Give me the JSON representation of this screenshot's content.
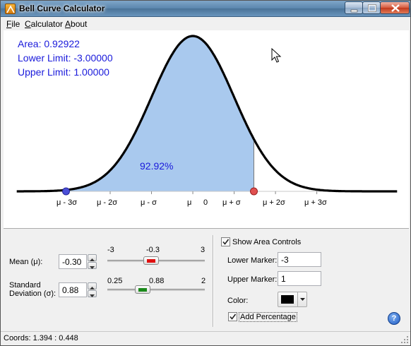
{
  "window": {
    "title": "Bell Curve Calculator"
  },
  "menu": [
    {
      "accel": "F",
      "rest": "ile"
    },
    {
      "accel": "C",
      "rest": "alculator"
    },
    {
      "accel": "A",
      "rest": "bout"
    }
  ],
  "results": {
    "area_line": "Area: 0.92922",
    "lower_line": "Lower Limit: -3.00000",
    "upper_line": "Upper Limit: 1.00000",
    "percentage": "92.92%"
  },
  "axis": {
    "labels": [
      "μ - 3σ",
      "μ - 2σ",
      "μ - σ",
      "μ",
      "0",
      "μ + σ",
      "μ + 2σ",
      "μ + 3σ"
    ]
  },
  "controls": {
    "mean": {
      "label": "Mean (μ):",
      "value": "-0.30",
      "min_label": "-3",
      "current_label": "-0.3",
      "max_label": "3",
      "min": -3,
      "max": 3,
      "current": -0.3,
      "thumb_color": "#e01010"
    },
    "stddev": {
      "label_line1": "Standard",
      "label_line2": "Deviation (σ):",
      "value": "0.88",
      "min_label": "0.25",
      "current_label": "0.88",
      "max_label": "2",
      "min": 0.25,
      "max": 2,
      "current": 0.88,
      "thumb_color": "#1a8a1a"
    },
    "show_area_controls": {
      "label": "Show Area Controls",
      "checked": true
    },
    "lower_marker": {
      "label": "Lower Marker:",
      "value": "-3"
    },
    "upper_marker": {
      "label": "Upper Marker:",
      "value": "1"
    },
    "color": {
      "label": "Color:",
      "value": "#000000"
    },
    "add_percentage": {
      "label": "Add Percentage",
      "checked": true
    },
    "help_icon": "help-icon"
  },
  "status": {
    "coords": "Coords: 1.394 : 0.448"
  },
  "colors": {
    "fill": "#a9c9ee",
    "curve": "#000000",
    "text_accent": "#1a1adb",
    "lower_marker": "#4a4fd8",
    "upper_marker": "#e05050"
  }
}
